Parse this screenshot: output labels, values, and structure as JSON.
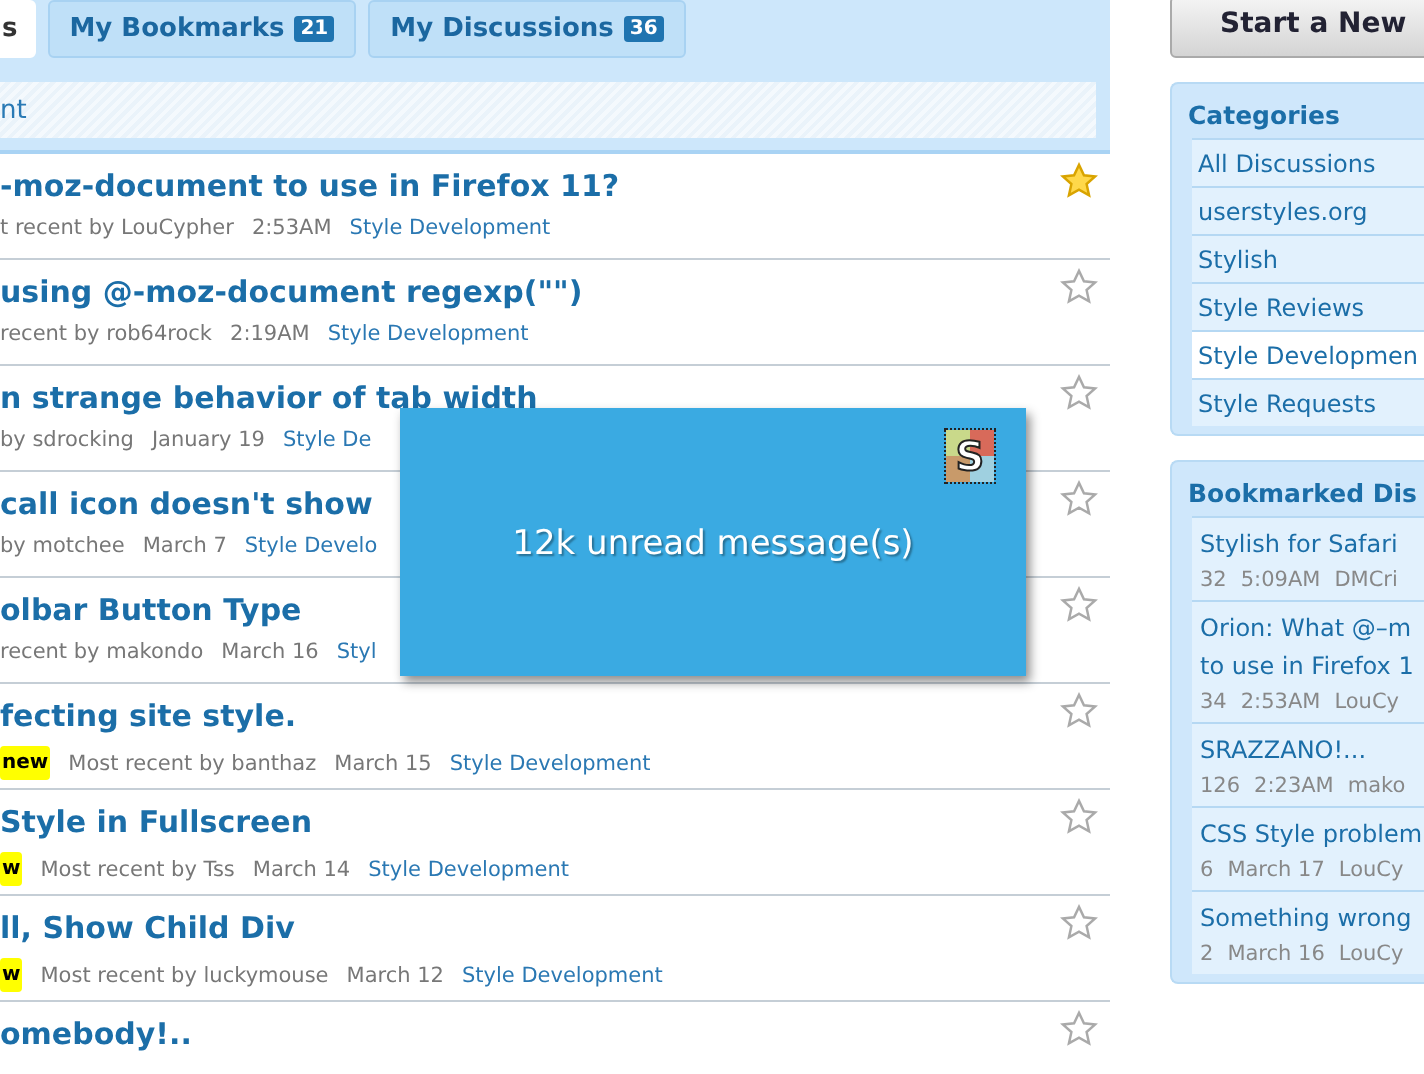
{
  "tabs": [
    {
      "label": "s",
      "selected": true
    },
    {
      "label": "My Bookmarks",
      "count": "21",
      "selected": false
    },
    {
      "label": "My Discussions",
      "count": "36",
      "selected": false
    }
  ],
  "filter_bar": {
    "text": "nt"
  },
  "discussions": [
    {
      "title": "-moz-document to use in Firefox 11?",
      "meta": "t recent by LouCypher",
      "time": "2:53AM",
      "category": "Style Development",
      "bookmarked": true
    },
    {
      "title": "using @-moz-document regexp(\"\")",
      "meta": "recent by rob64rock",
      "time": "2:19AM",
      "category": "Style Development",
      "bookmarked": false
    },
    {
      "title": "n strange behavior of tab width",
      "meta": "by sdrocking",
      "time": "January 19",
      "category": "Style De",
      "bookmarked": false
    },
    {
      "title": "call icon doesn't show",
      "meta": "by motchee",
      "time": "March 7",
      "category": "Style Develo",
      "bookmarked": false
    },
    {
      "title": "olbar Button Type",
      "meta": "recent by makondo",
      "time": "March 16",
      "category": "Styl",
      "bookmarked": false
    },
    {
      "title": "fecting site style.",
      "badge": "new",
      "meta": "Most recent by banthaz",
      "time": "March 15",
      "category": "Style Development",
      "bookmarked": false
    },
    {
      "title": "Style in Fullscreen",
      "badge": "w",
      "meta": "Most recent by Tss",
      "time": "March 14",
      "category": "Style Development",
      "bookmarked": false
    },
    {
      "title": "ll, Show Child Div",
      "badge": "w",
      "meta": "Most recent by luckymouse",
      "time": "March 12",
      "category": "Style Development",
      "bookmarked": false
    },
    {
      "title": "omebody!..",
      "bookmarked": false
    }
  ],
  "start_button": "Start a New",
  "categories": {
    "title": "Categories",
    "items": [
      {
        "label": "All Discussions",
        "selected": false
      },
      {
        "label": "userstyles.org",
        "selected": false
      },
      {
        "label": "Stylish",
        "selected": false
      },
      {
        "label": "Style Reviews",
        "selected": false
      },
      {
        "label": "Style Developmen",
        "selected": true
      },
      {
        "label": "Style Requests",
        "selected": false
      }
    ]
  },
  "bookmarked": {
    "title": "Bookmarked Dis",
    "items": [
      {
        "title_lines": [
          "Stylish for Safari"
        ],
        "count": "32",
        "time": "5:09AM",
        "author": "DMCri"
      },
      {
        "title_lines": [
          "Orion: What @–m",
          "to use in Firefox 1"
        ],
        "count": "34",
        "time": "2:53AM",
        "author": "LouCy"
      },
      {
        "title_lines": [
          "SRAZZANO!..."
        ],
        "count": "126",
        "time": "2:23AM",
        "author": "mako"
      },
      {
        "title_lines": [
          "CSS Style problem"
        ],
        "count": "6",
        "time": "March 17",
        "author": "LouCy"
      },
      {
        "title_lines": [
          "Something wrong"
        ],
        "count": "2",
        "time": "March 16",
        "author": "LouCy"
      }
    ]
  },
  "notification": {
    "icon_letter": "S",
    "message": "12k unread message(s)"
  }
}
